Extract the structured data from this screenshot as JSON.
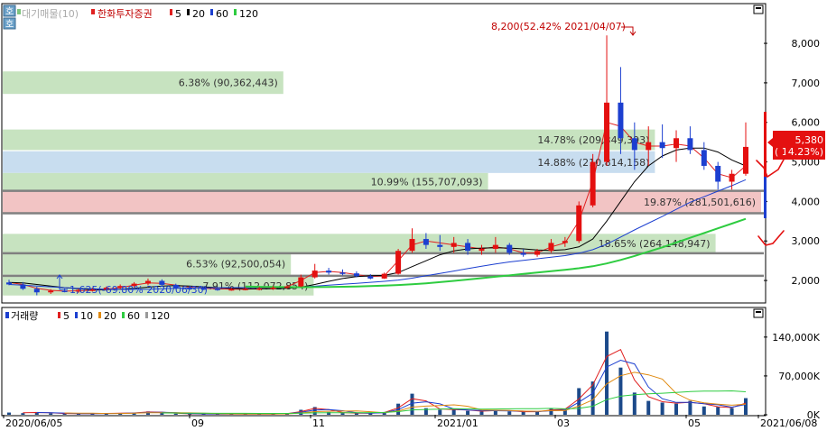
{
  "price_legend": {
    "toggle_label": "호",
    "volume_profile": "대기매물(10)",
    "title": "한화투자증권",
    "ma_items": [
      {
        "label": "5",
        "color": "#e02020"
      },
      {
        "label": "20",
        "color": "#000000"
      },
      {
        "label": "60",
        "color": "#1c3fd0"
      },
      {
        "label": "120",
        "color": "#2ecc40"
      }
    ]
  },
  "volume_legend": {
    "title": "거래량",
    "ma_items": [
      {
        "label": "5",
        "color": "#e02020"
      },
      {
        "label": "10",
        "color": "#1c3fd0"
      },
      {
        "label": "20",
        "color": "#e08a10"
      },
      {
        "label": "60",
        "color": "#2ecc40"
      },
      {
        "label": "120",
        "color": "#999999"
      }
    ]
  },
  "annotations": {
    "high": "8,200(52.42% 2021/04/07)",
    "low": "1,625(-69.80% 2020/06/30)",
    "current_price": "5,380",
    "current_change": "( 14.23%)"
  },
  "chart_data": [
    {
      "type": "candlestick",
      "title": "한화투자증권",
      "ylim": [
        1500,
        8800
      ],
      "y_ticks": [
        2000,
        3000,
        4000,
        5000,
        6000,
        7000,
        8000
      ],
      "y_tick_labels": [
        "2,000",
        "3,000",
        "4,000",
        "5,000",
        "6,000",
        "7,000",
        "8,000"
      ],
      "x_tick_labels": [
        "2020/06/05",
        "09",
        "11",
        "2021/01",
        "03",
        "05",
        "2021/06/08"
      ],
      "volume_profile": [
        {
          "price_low": 6720,
          "price_high": 7290,
          "label": "6.38% (90,362,443)",
          "width": 0.37,
          "color": "#c7e3c0"
        },
        {
          "price_low": 5300,
          "price_high": 5820,
          "label": "14.78% (209,349,393)",
          "width": 0.86,
          "color": "#c7e3c0"
        },
        {
          "price_low": 4720,
          "price_high": 5270,
          "label": "14.88% (210,814,158)",
          "width": 0.86,
          "color": "#c8ddef"
        },
        {
          "price_low": 4280,
          "price_high": 4720,
          "label": "10.99% (155,707,093)",
          "width": 0.64,
          "color": "#c7e3c0"
        },
        {
          "price_low": 3720,
          "price_high": 4250,
          "label": "19.87% (281,501,616)",
          "width": 1.0,
          "color": "#f2c4c4"
        },
        {
          "price_low": 2700,
          "price_high": 3180,
          "label": "18.65% (264,148,947)",
          "width": 0.94,
          "color": "#c7e3c0"
        },
        {
          "price_low": 2150,
          "price_high": 2690,
          "label": "6.53% (92,500,054)",
          "width": 0.38,
          "color": "#c7e3c0"
        },
        {
          "price_low": 1620,
          "price_high": 2100,
          "label": "7.91% (112,072,854)",
          "width": 0.41,
          "color": "#c7e3c0"
        }
      ],
      "ohlc_weekly": [
        {
          "o": 1950,
          "h": 2020,
          "l": 1880,
          "c": 1900
        },
        {
          "o": 1900,
          "h": 1960,
          "l": 1760,
          "c": 1790
        },
        {
          "o": 1790,
          "h": 1840,
          "l": 1625,
          "c": 1700
        },
        {
          "o": 1700,
          "h": 1780,
          "l": 1660,
          "c": 1740
        },
        {
          "o": 1740,
          "h": 1800,
          "l": 1700,
          "c": 1720
        },
        {
          "o": 1720,
          "h": 1790,
          "l": 1690,
          "c": 1760
        },
        {
          "o": 1760,
          "h": 1820,
          "l": 1720,
          "c": 1770
        },
        {
          "o": 1770,
          "h": 1850,
          "l": 1740,
          "c": 1820
        },
        {
          "o": 1820,
          "h": 1900,
          "l": 1780,
          "c": 1860
        },
        {
          "o": 1860,
          "h": 1960,
          "l": 1830,
          "c": 1920
        },
        {
          "o": 1920,
          "h": 2050,
          "l": 1880,
          "c": 1990
        },
        {
          "o": 1990,
          "h": 2030,
          "l": 1870,
          "c": 1890
        },
        {
          "o": 1890,
          "h": 1920,
          "l": 1790,
          "c": 1810
        },
        {
          "o": 1810,
          "h": 1860,
          "l": 1760,
          "c": 1800
        },
        {
          "o": 1800,
          "h": 1850,
          "l": 1760,
          "c": 1790
        },
        {
          "o": 1790,
          "h": 1830,
          "l": 1740,
          "c": 1770
        },
        {
          "o": 1770,
          "h": 1820,
          "l": 1740,
          "c": 1780
        },
        {
          "o": 1780,
          "h": 1830,
          "l": 1750,
          "c": 1790
        },
        {
          "o": 1790,
          "h": 1840,
          "l": 1750,
          "c": 1800
        },
        {
          "o": 1800,
          "h": 1860,
          "l": 1760,
          "c": 1820
        },
        {
          "o": 1820,
          "h": 1880,
          "l": 1790,
          "c": 1850
        },
        {
          "o": 1850,
          "h": 2150,
          "l": 1830,
          "c": 2080
        },
        {
          "o": 2080,
          "h": 2420,
          "l": 2050,
          "c": 2250
        },
        {
          "o": 2250,
          "h": 2320,
          "l": 2150,
          "c": 2200
        },
        {
          "o": 2200,
          "h": 2280,
          "l": 2130,
          "c": 2180
        },
        {
          "o": 2180,
          "h": 2230,
          "l": 2080,
          "c": 2110
        },
        {
          "o": 2110,
          "h": 2160,
          "l": 2030,
          "c": 2050
        },
        {
          "o": 2050,
          "h": 2200,
          "l": 2040,
          "c": 2170
        },
        {
          "o": 2170,
          "h": 2800,
          "l": 2150,
          "c": 2750
        },
        {
          "o": 2750,
          "h": 3320,
          "l": 2700,
          "c": 3050
        },
        {
          "o": 3050,
          "h": 3200,
          "l": 2800,
          "c": 2900
        },
        {
          "o": 2900,
          "h": 3150,
          "l": 2750,
          "c": 2850
        },
        {
          "o": 2850,
          "h": 3100,
          "l": 2700,
          "c": 2950
        },
        {
          "o": 2950,
          "h": 3050,
          "l": 2650,
          "c": 2750
        },
        {
          "o": 2750,
          "h": 2900,
          "l": 2650,
          "c": 2800
        },
        {
          "o": 2800,
          "h": 3100,
          "l": 2700,
          "c": 2900
        },
        {
          "o": 2900,
          "h": 2950,
          "l": 2650,
          "c": 2700
        },
        {
          "o": 2700,
          "h": 2800,
          "l": 2600,
          "c": 2650
        },
        {
          "o": 2650,
          "h": 2800,
          "l": 2600,
          "c": 2750
        },
        {
          "o": 2750,
          "h": 3050,
          "l": 2700,
          "c": 2950
        },
        {
          "o": 2950,
          "h": 3100,
          "l": 2850,
          "c": 3000
        },
        {
          "o": 3000,
          "h": 4000,
          "l": 2950,
          "c": 3900
        },
        {
          "o": 3900,
          "h": 5200,
          "l": 3850,
          "c": 5000
        },
        {
          "o": 5000,
          "h": 8200,
          "l": 4900,
          "c": 6500
        },
        {
          "o": 6500,
          "h": 7400,
          "l": 5200,
          "c": 5600
        },
        {
          "o": 5600,
          "h": 6000,
          "l": 4800,
          "c": 5300
        },
        {
          "o": 5300,
          "h": 5900,
          "l": 4900,
          "c": 5500
        },
        {
          "o": 5500,
          "h": 5950,
          "l": 5100,
          "c": 5350
        },
        {
          "o": 5350,
          "h": 5800,
          "l": 5000,
          "c": 5600
        },
        {
          "o": 5600,
          "h": 5900,
          "l": 5200,
          "c": 5300
        },
        {
          "o": 5300,
          "h": 5500,
          "l": 4800,
          "c": 4900
        },
        {
          "o": 4900,
          "h": 5000,
          "l": 4300,
          "c": 4500
        },
        {
          "o": 4500,
          "h": 4800,
          "l": 4300,
          "c": 4700
        },
        {
          "o": 4700,
          "h": 6000,
          "l": 4650,
          "c": 5380
        }
      ],
      "moving_averages": [
        {
          "name": "5",
          "color": "#e02020",
          "values": [
            1950,
            1900,
            1800,
            1750,
            1730,
            1740,
            1750,
            1780,
            1820,
            1880,
            1940,
            1930,
            1880,
            1830,
            1800,
            1790,
            1780,
            1780,
            1790,
            1810,
            1840,
            2000,
            2200,
            2230,
            2200,
            2150,
            2100,
            2120,
            2500,
            2900,
            3000,
            2950,
            2900,
            2850,
            2800,
            2850,
            2800,
            2700,
            2700,
            2850,
            2950,
            3500,
            4500,
            6000,
            5900,
            5500,
            5400,
            5400,
            5450,
            5400,
            5100,
            4700,
            4600,
            4900
          ]
        },
        {
          "name": "20",
          "color": "#000000",
          "values": [
            1950,
            1940,
            1900,
            1860,
            1820,
            1790,
            1770,
            1770,
            1780,
            1800,
            1830,
            1860,
            1870,
            1860,
            1840,
            1820,
            1800,
            1790,
            1790,
            1790,
            1800,
            1830,
            1900,
            1980,
            2050,
            2100,
            2120,
            2130,
            2200,
            2350,
            2500,
            2650,
            2750,
            2800,
            2820,
            2830,
            2820,
            2800,
            2770,
            2760,
            2780,
            2850,
            3050,
            3500,
            4000,
            4500,
            4900,
            5150,
            5300,
            5350,
            5350,
            5250,
            5050,
            4900
          ]
        },
        {
          "name": "60",
          "color": "#1c3fd0",
          "values": [
            1900,
            1880,
            1860,
            1840,
            1820,
            1800,
            1790,
            1780,
            1775,
            1775,
            1780,
            1790,
            1800,
            1810,
            1815,
            1818,
            1820,
            1820,
            1820,
            1822,
            1825,
            1835,
            1855,
            1880,
            1905,
            1930,
            1955,
            1980,
            2010,
            2060,
            2120,
            2180,
            2240,
            2300,
            2360,
            2420,
            2470,
            2510,
            2550,
            2590,
            2630,
            2690,
            2780,
            2920,
            3100,
            3280,
            3450,
            3620,
            3800,
            3980,
            4120,
            4260,
            4400,
            4550
          ]
        },
        {
          "name": "120",
          "color": "#2ecc40",
          "values": [
            null,
            null,
            null,
            null,
            null,
            null,
            null,
            null,
            null,
            null,
            null,
            null,
            null,
            null,
            null,
            null,
            null,
            1850,
            1840,
            1835,
            1832,
            1830,
            1832,
            1836,
            1842,
            1850,
            1860,
            1872,
            1885,
            1905,
            1930,
            1958,
            1990,
            2025,
            2060,
            2095,
            2130,
            2165,
            2200,
            2235,
            2270,
            2310,
            2360,
            2430,
            2520,
            2620,
            2730,
            2840,
            2960,
            3080,
            3200,
            3320,
            3440,
            3560
          ]
        }
      ]
    },
    {
      "type": "bar",
      "title": "거래량",
      "y_ticks": [
        0,
        70000,
        140000
      ],
      "y_tick_labels": [
        "0K",
        "70,000K",
        "140,000K"
      ],
      "ylim": [
        0,
        182000
      ],
      "volume_weekly": [
        4000,
        3000,
        5000,
        2500,
        2000,
        2000,
        2000,
        3000,
        2500,
        4000,
        6000,
        3500,
        2000,
        1500,
        1500,
        1500,
        1500,
        1500,
        1500,
        1500,
        2500,
        9000,
        14000,
        5000,
        3000,
        3000,
        3000,
        5000,
        20000,
        38000,
        12000,
        9000,
        10000,
        7000,
        6000,
        9000,
        6000,
        5000,
        6000,
        11000,
        9000,
        48000,
        60000,
        150000,
        85000,
        40000,
        25000,
        22000,
        20000,
        25000,
        15000,
        14000,
        12000,
        30000
      ]
    }
  ]
}
